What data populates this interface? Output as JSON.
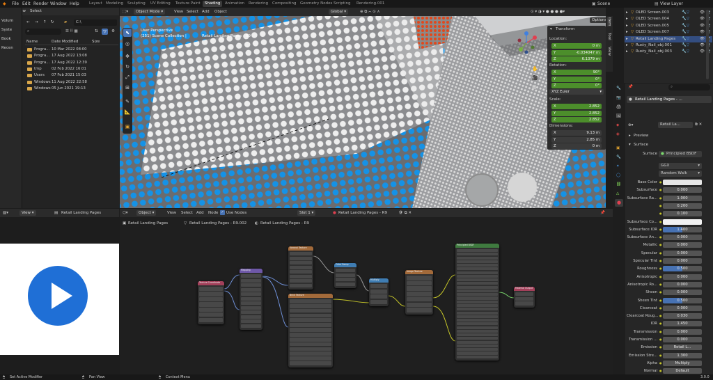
{
  "topbar": {
    "menus": [
      "File",
      "Edit",
      "Render",
      "Window",
      "Help"
    ],
    "workspaces": [
      "Layout",
      "Modeling",
      "Sculpting",
      "UV Editing",
      "Texture Paint",
      "Shading",
      "Animation",
      "Rendering",
      "Compositing",
      "Geometry Nodes",
      "Scripting",
      "Rendering.001"
    ],
    "active_workspace": "Shading",
    "scene": "Scene",
    "view_layer": "View Layer"
  },
  "file_browser": {
    "menus": [
      "View",
      "Select"
    ],
    "path": "C:\\",
    "sidebar": [
      "Volum",
      "Syste",
      "Book",
      "Recen"
    ],
    "columns": [
      "Name",
      "Date Modified",
      "Size"
    ],
    "rows": [
      {
        "name": "Progra...",
        "date": "10 Mar 2022 08:00"
      },
      {
        "name": "Progra...",
        "date": "17 Aug 2022 13:08"
      },
      {
        "name": "Progra...",
        "date": "17 Aug 2022 12:39"
      },
      {
        "name": "tmp",
        "date": "02 Feb 2022 16:01"
      },
      {
        "name": "Users",
        "date": "07 Feb 2021 15:03"
      },
      {
        "name": "Windows",
        "date": "11 Aug 2022 22:58"
      },
      {
        "name": "Windows",
        "date": "05 Jun 2021 19:13"
      }
    ]
  },
  "viewport": {
    "mode": "Object Mode",
    "menus": [
      "View",
      "Select",
      "Add",
      "Object"
    ],
    "orientation": "Global",
    "options": "Options",
    "view_name": "User Perspective",
    "collection": "(251) Scene Collection |",
    "object_name": "Retail Landing Pages - R9",
    "tabs": [
      "Item",
      "Tool",
      "View"
    ]
  },
  "transform": {
    "title": "Transform",
    "location_label": "Location:",
    "location": [
      {
        "axis": "X",
        "value": "0 m"
      },
      {
        "axis": "Y",
        "value": "-0.034047 m"
      },
      {
        "axis": "Z",
        "value": "6.1379 m"
      }
    ],
    "rotation_label": "Rotation:",
    "rotation": [
      {
        "axis": "X",
        "value": "90°"
      },
      {
        "axis": "Y",
        "value": "0°"
      },
      {
        "axis": "Z",
        "value": "0°"
      }
    ],
    "rotation_mode": "XYZ Euler",
    "scale_label": "Scale:",
    "scale": [
      {
        "axis": "X",
        "value": "2.852"
      },
      {
        "axis": "Y",
        "value": "2.852"
      },
      {
        "axis": "Z",
        "value": "2.852"
      }
    ],
    "dimensions_label": "Dimensions:",
    "dimensions": [
      {
        "axis": "X",
        "value": "9.13 m"
      },
      {
        "axis": "Y",
        "value": "2.85 m"
      },
      {
        "axis": "Z",
        "value": "0 m"
      }
    ]
  },
  "outliner": {
    "items": [
      "OLED Screen.003",
      "OLED Screen.004",
      "OLED Screen.005",
      "OLED Screen.007",
      "Retail Landing Pages",
      "Rusty_Nail_obj.001",
      "Rusty_Nail_obj.003"
    ]
  },
  "properties": {
    "material": "Retail Landing Pages - ...",
    "object_field": "Retail La...",
    "preview_label": "Preview",
    "surface_label": "Surface",
    "surface_shader": "Principled BSDF",
    "distribution": "GGX",
    "subsurface_method": "Random Walk",
    "rows": [
      {
        "label": "Base Color",
        "value": ""
      },
      {
        "label": "Subsurface",
        "value": "0.000"
      },
      {
        "label": "Subsurface Ra...",
        "value": "1.000"
      },
      {
        "label": "",
        "value": "0.200"
      },
      {
        "label": "",
        "value": "0.100"
      },
      {
        "label": "Subsurface Co...",
        "value": ""
      },
      {
        "label": "Subsurface IOR",
        "value": "1.400"
      },
      {
        "label": "Subsurface An...",
        "value": "0.000"
      },
      {
        "label": "Metallic",
        "value": "0.000"
      },
      {
        "label": "Specular",
        "value": "0.000"
      },
      {
        "label": "Specular Tint",
        "value": "0.000"
      },
      {
        "label": "Roughness",
        "value": "0.500"
      },
      {
        "label": "Anisotropic",
        "value": "0.000"
      },
      {
        "label": "Anisotropic Ro...",
        "value": "0.000"
      },
      {
        "label": "Sheen",
        "value": "0.000"
      },
      {
        "label": "Sheen Tint",
        "value": "0.500"
      },
      {
        "label": "Clearcoat",
        "value": "0.000"
      },
      {
        "label": "Clearcoat Roug...",
        "value": "0.030"
      },
      {
        "label": "IOR",
        "value": "1.450"
      },
      {
        "label": "Transmission",
        "value": "0.000"
      },
      {
        "label": "Transmission ...",
        "value": "0.000"
      },
      {
        "label": "Emission",
        "value": "Retail L..."
      },
      {
        "label": "Emission Stre...",
        "value": "1.300"
      },
      {
        "label": "Alpha",
        "value": "Multiply"
      },
      {
        "label": "Normal",
        "value": "Default"
      }
    ]
  },
  "video_panel": {
    "menu": "View",
    "title": "Retail Landing Pages"
  },
  "node_editor": {
    "mode": "Object",
    "menus": [
      "View",
      "Select",
      "Add",
      "Node"
    ],
    "use_nodes": "Use Nodes",
    "slot": "Slot 1",
    "material": "Retail Landing Pages - R9",
    "breadcrumbs": [
      "Retail Landing Pages",
      "Retail Landing Pages - R9.002",
      "Retail Landing Pages - R9"
    ],
    "node_titles": [
      "Texture Coordinate",
      "Mapping",
      "Voronoi Texture",
      "Brick Texture",
      "Color Ramp",
      "Multiply",
      "Image Texture",
      "Principled BSDF",
      "Material Output"
    ]
  },
  "status": {
    "left": "Set Active Modifier",
    "mid": "Pan View",
    "right": "Context Menu",
    "version": "3.0.0"
  },
  "colors": {
    "accent": "#4772b3",
    "field_green": "#4c8e2b",
    "folder": "#d9a74a",
    "play_blue": "#1f6fd6"
  }
}
